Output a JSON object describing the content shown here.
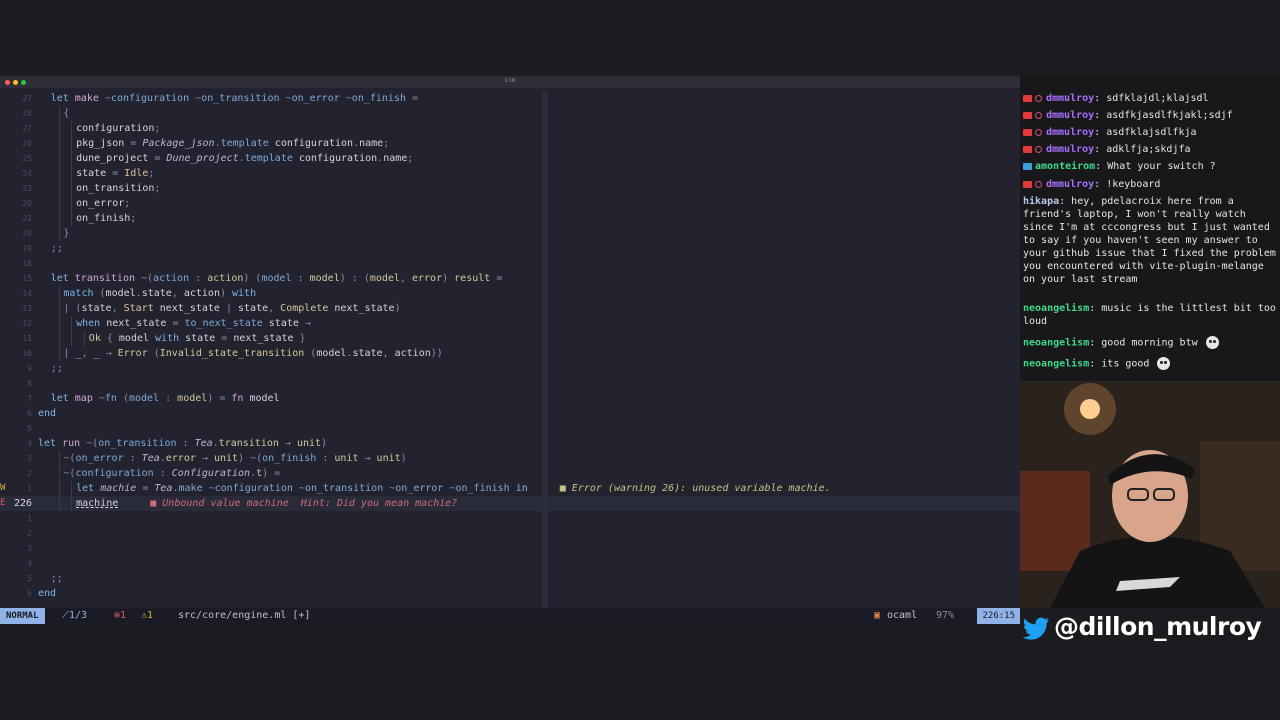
{
  "window": {
    "title": "vim"
  },
  "editor": {
    "lines": [
      {
        "num": "27",
        "sign": "",
        "current": false,
        "indent": 1,
        "segs": [
          [
            "kw",
            "let "
          ],
          [
            "fn",
            "make "
          ],
          [
            "op",
            "~"
          ],
          [
            "lb",
            "configuration "
          ],
          [
            "op",
            "~"
          ],
          [
            "lb",
            "on_transition "
          ],
          [
            "op",
            "~"
          ],
          [
            "lb",
            "on_error "
          ],
          [
            "op",
            "~"
          ],
          [
            "lb",
            "on_finish "
          ],
          [
            "op",
            "="
          ]
        ]
      },
      {
        "num": "28",
        "sign": "",
        "current": false,
        "indent": 2,
        "segs": [
          [
            "op",
            "{"
          ]
        ]
      },
      {
        "num": "27",
        "sign": "",
        "current": false,
        "indent": 3,
        "segs": [
          [
            "var",
            "configuration"
          ],
          [
            "op",
            ";"
          ]
        ]
      },
      {
        "num": "26",
        "sign": "",
        "current": false,
        "indent": 3,
        "segs": [
          [
            "var",
            "pkg_json "
          ],
          [
            "op",
            "= "
          ],
          [
            "it",
            "Package_json"
          ],
          [
            "op",
            "."
          ],
          [
            "lb",
            "template "
          ],
          [
            "var",
            "configuration"
          ],
          [
            "op",
            "."
          ],
          [
            "var",
            "name"
          ],
          [
            "op",
            ";"
          ]
        ]
      },
      {
        "num": "25",
        "sign": "",
        "current": false,
        "indent": 3,
        "segs": [
          [
            "var",
            "dune_project "
          ],
          [
            "op",
            "= "
          ],
          [
            "it",
            "Dune_project"
          ],
          [
            "op",
            "."
          ],
          [
            "lb",
            "template "
          ],
          [
            "var",
            "configuration"
          ],
          [
            "op",
            "."
          ],
          [
            "var",
            "name"
          ],
          [
            "op",
            ";"
          ]
        ]
      },
      {
        "num": "24",
        "sign": "",
        "current": false,
        "indent": 3,
        "segs": [
          [
            "var",
            "state "
          ],
          [
            "op",
            "= "
          ],
          [
            "tp",
            "Idle"
          ],
          [
            "op",
            ";"
          ]
        ]
      },
      {
        "num": "23",
        "sign": "",
        "current": false,
        "indent": 3,
        "segs": [
          [
            "var",
            "on_transition"
          ],
          [
            "op",
            ";"
          ]
        ]
      },
      {
        "num": "20",
        "sign": "",
        "current": false,
        "indent": 3,
        "segs": [
          [
            "var",
            "on_error"
          ],
          [
            "op",
            ";"
          ]
        ]
      },
      {
        "num": "21",
        "sign": "",
        "current": false,
        "indent": 3,
        "segs": [
          [
            "var",
            "on_finish"
          ],
          [
            "op",
            ";"
          ]
        ]
      },
      {
        "num": "20",
        "sign": "",
        "current": false,
        "indent": 2,
        "segs": [
          [
            "op",
            "}"
          ]
        ]
      },
      {
        "num": "19",
        "sign": "",
        "current": false,
        "indent": 1,
        "segs": [
          [
            "op",
            ";;"
          ]
        ]
      },
      {
        "num": "18",
        "sign": "",
        "current": false,
        "indent": 0,
        "segs": []
      },
      {
        "num": "15",
        "sign": "",
        "current": false,
        "indent": 1,
        "segs": [
          [
            "kw",
            "let "
          ],
          [
            "fn",
            "transition "
          ],
          [
            "op",
            "~("
          ],
          [
            "lb",
            "action "
          ],
          [
            "op",
            ": "
          ],
          [
            "tp",
            "action"
          ],
          [
            "op",
            ") ("
          ],
          [
            "lb",
            "model "
          ],
          [
            "op",
            ": "
          ],
          [
            "tp",
            "model"
          ],
          [
            "op",
            ") : ("
          ],
          [
            "tp",
            "model"
          ],
          [
            "op",
            ", "
          ],
          [
            "tp",
            "error"
          ],
          [
            "op",
            ") "
          ],
          [
            "tp",
            "result "
          ],
          [
            "op",
            "="
          ]
        ]
      },
      {
        "num": "14",
        "sign": "",
        "current": false,
        "indent": 2,
        "segs": [
          [
            "kw",
            "match "
          ],
          [
            "op",
            "("
          ],
          [
            "var",
            "model"
          ],
          [
            "op",
            "."
          ],
          [
            "var",
            "state"
          ],
          [
            "op",
            ", "
          ],
          [
            "var",
            "action"
          ],
          [
            "op",
            ") "
          ],
          [
            "kw",
            "with"
          ]
        ]
      },
      {
        "num": "13",
        "sign": "",
        "current": false,
        "indent": 2,
        "segs": [
          [
            "op",
            "| ("
          ],
          [
            "var",
            "state"
          ],
          [
            "op",
            ", "
          ],
          [
            "tp",
            "Start "
          ],
          [
            "var",
            "next_state "
          ],
          [
            "op",
            "| "
          ],
          [
            "var",
            "state"
          ],
          [
            "op",
            ", "
          ],
          [
            "tp",
            "Complete "
          ],
          [
            "var",
            "next_state"
          ],
          [
            "op",
            ")"
          ]
        ]
      },
      {
        "num": "12",
        "sign": "",
        "current": false,
        "indent": 3,
        "segs": [
          [
            "kw",
            "when "
          ],
          [
            "var",
            "next_state "
          ],
          [
            "op",
            "= "
          ],
          [
            "lb",
            "to_next_state "
          ],
          [
            "var",
            "state "
          ],
          [
            "op",
            "→"
          ]
        ]
      },
      {
        "num": "11",
        "sign": "",
        "current": false,
        "indent": 4,
        "segs": [
          [
            "tp",
            "Ok "
          ],
          [
            "op",
            "{ "
          ],
          [
            "var",
            "model "
          ],
          [
            "kw",
            "with "
          ],
          [
            "var",
            "state "
          ],
          [
            "op",
            "= "
          ],
          [
            "var",
            "next_state "
          ],
          [
            "op",
            "}"
          ]
        ]
      },
      {
        "num": "10",
        "sign": "",
        "current": false,
        "indent": 2,
        "segs": [
          [
            "op",
            "| "
          ],
          [
            "var",
            "_"
          ],
          [
            "op",
            ", "
          ],
          [
            "var",
            "_ "
          ],
          [
            "op",
            "→ "
          ],
          [
            "tp",
            "Error "
          ],
          [
            "op",
            "("
          ],
          [
            "tp",
            "Invalid_state_transition "
          ],
          [
            "op",
            "("
          ],
          [
            "var",
            "model"
          ],
          [
            "op",
            "."
          ],
          [
            "var",
            "state"
          ],
          [
            "op",
            ", "
          ],
          [
            "var",
            "action"
          ],
          [
            "op",
            "))"
          ]
        ]
      },
      {
        "num": "9",
        "sign": "",
        "current": false,
        "indent": 1,
        "segs": [
          [
            "op",
            ";;"
          ]
        ]
      },
      {
        "num": "8",
        "sign": "",
        "current": false,
        "indent": 0,
        "segs": []
      },
      {
        "num": "7",
        "sign": "",
        "current": false,
        "indent": 1,
        "segs": [
          [
            "kw",
            "let "
          ],
          [
            "fn",
            "map "
          ],
          [
            "op",
            "~"
          ],
          [
            "lb",
            "fn "
          ],
          [
            "op",
            "("
          ],
          [
            "lb",
            "model "
          ],
          [
            "op",
            ": "
          ],
          [
            "tp",
            "model"
          ],
          [
            "op",
            ") = "
          ],
          [
            "fn",
            "fn "
          ],
          [
            "var",
            "model"
          ]
        ]
      },
      {
        "num": "6",
        "sign": "",
        "current": false,
        "indent": 0,
        "segs": [
          [
            "kw",
            "end"
          ]
        ]
      },
      {
        "num": "5",
        "sign": "",
        "current": false,
        "indent": 0,
        "segs": []
      },
      {
        "num": "4",
        "sign": "",
        "current": false,
        "indent": 0,
        "segs": [
          [
            "kw",
            "let "
          ],
          [
            "fn",
            "run "
          ],
          [
            "op",
            "~("
          ],
          [
            "lb",
            "on_transition "
          ],
          [
            "op",
            ": "
          ],
          [
            "it",
            "Tea"
          ],
          [
            "op",
            "."
          ],
          [
            "tp",
            "transition "
          ],
          [
            "op",
            "→ "
          ],
          [
            "tp",
            "unit"
          ],
          [
            "op",
            ")"
          ]
        ]
      },
      {
        "num": "3",
        "sign": "",
        "current": false,
        "indent": 2,
        "segs": [
          [
            "op",
            "~("
          ],
          [
            "lb",
            "on_error "
          ],
          [
            "op",
            ": "
          ],
          [
            "it",
            "Tea"
          ],
          [
            "op",
            "."
          ],
          [
            "tp",
            "error "
          ],
          [
            "op",
            "→ "
          ],
          [
            "tp",
            "unit"
          ],
          [
            "op",
            ") ~("
          ],
          [
            "lb",
            "on_finish "
          ],
          [
            "op",
            ": "
          ],
          [
            "tp",
            "unit "
          ],
          [
            "op",
            "→ "
          ],
          [
            "tp",
            "unit"
          ],
          [
            "op",
            ")"
          ]
        ]
      },
      {
        "num": "2",
        "sign": "",
        "current": false,
        "indent": 2,
        "segs": [
          [
            "op",
            "~("
          ],
          [
            "lb",
            "configuration "
          ],
          [
            "op",
            ": "
          ],
          [
            "it",
            "Configuration"
          ],
          [
            "op",
            "."
          ],
          [
            "tp",
            "t"
          ],
          [
            "op",
            ") ="
          ]
        ]
      },
      {
        "num": "1",
        "sign": "W",
        "current": false,
        "indent": 3,
        "segs": [
          [
            "kw",
            "let "
          ],
          [
            "it",
            "machie "
          ],
          [
            "op",
            "= "
          ],
          [
            "it",
            "Tea"
          ],
          [
            "op",
            "."
          ],
          [
            "lb",
            "make "
          ],
          [
            "op",
            "~"
          ],
          [
            "lb",
            "configuration "
          ],
          [
            "op",
            "~"
          ],
          [
            "lb",
            "on_transition "
          ],
          [
            "op",
            "~"
          ],
          [
            "lb",
            "on_error "
          ],
          [
            "op",
            "~"
          ],
          [
            "lb",
            "on_finish "
          ],
          [
            "kw",
            "in"
          ]
        ],
        "diag": "■ Error (warning 26): unused variable machie.",
        "diag_kind": "w"
      },
      {
        "num": "226",
        "sign": "E",
        "current": true,
        "indent": 3,
        "segs": [
          [
            "var u",
            "machine"
          ]
        ],
        "diag": "■ Unbound value machine  Hint: Did you mean machie?",
        "diag_kind": "e"
      },
      {
        "num": "1",
        "sign": "",
        "current": false,
        "indent": 0,
        "segs": []
      },
      {
        "num": "2",
        "sign": "",
        "current": false,
        "indent": 0,
        "segs": []
      },
      {
        "num": "3",
        "sign": "",
        "current": false,
        "indent": 0,
        "segs": []
      },
      {
        "num": "4",
        "sign": "",
        "current": false,
        "indent": 0,
        "segs": []
      },
      {
        "num": "5",
        "sign": "",
        "current": false,
        "indent": 1,
        "segs": [
          [
            "op",
            ";;"
          ]
        ]
      },
      {
        "num": "6",
        "sign": "",
        "current": false,
        "indent": 0,
        "segs": [
          [
            "kw",
            "end"
          ]
        ]
      }
    ]
  },
  "statusbar": {
    "mode": "NORMAL",
    "hunks": "⟋1/3",
    "errors": "⊗1",
    "warnings": "⚠1",
    "file": "src/core/engine.ml [+]",
    "filetype": "ocaml",
    "percent": "97%",
    "position": "226:15"
  },
  "chat": {
    "messages": [
      {
        "user": "dmmulroy",
        "color": "#a970ff",
        "badges": 2,
        "text": "sdfklajdl;klajsdl"
      },
      {
        "user": "dmmulroy",
        "color": "#a970ff",
        "badges": 2,
        "text": "asdfkjasdlfkjakl;sdjf"
      },
      {
        "user": "dmmulroy",
        "color": "#a970ff",
        "badges": 2,
        "text": "asdfklajsdlfkja"
      },
      {
        "user": "dmmulroy",
        "color": "#a970ff",
        "badges": 2,
        "text": "adklfja;skdjfa"
      },
      {
        "user": "amonteirom",
        "color": "#3fd98a",
        "badges": 1,
        "text": "What your switch ?"
      },
      {
        "user": "dmmulroy",
        "color": "#a970ff",
        "badges": 2,
        "text": "!keyboard"
      },
      {
        "user": "hikapa",
        "color": "#b8c8e8",
        "badges": 0,
        "text": "hey, pdelacroix here from a friend's laptop, I won't really watch since I'm at cccongress but I just wanted to say if you haven't seen my answer to your github issue that I fixed the problem you encountered with vite-plugin-melange on your last stream"
      },
      {
        "user": "neoangelism",
        "color": "#3fd98a",
        "badges": 0,
        "text": "music is the littlest bit too loud"
      },
      {
        "user": "neoangelism",
        "color": "#3fd98a",
        "badges": 0,
        "text": "good morning btw",
        "emote": "face-emote"
      },
      {
        "user": "neoangelism",
        "color": "#3fd98a",
        "badges": 0,
        "text": "its good",
        "emote": "face-emote"
      }
    ]
  },
  "webcam": {
    "icon": "person-icon"
  },
  "social": {
    "handle": "@dillon_mulroy",
    "icon": "twitter-bird-icon"
  }
}
